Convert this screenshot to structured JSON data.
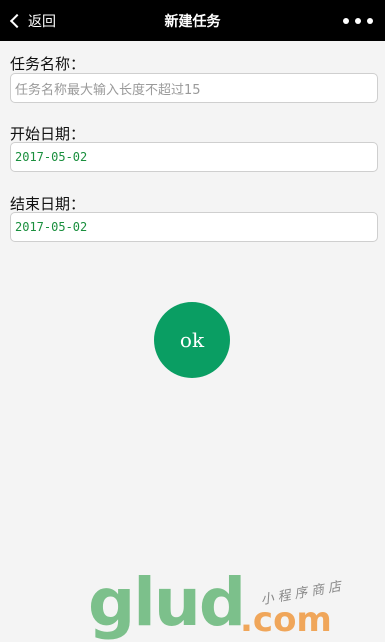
{
  "navbar": {
    "back_label": "返回",
    "title": "新建任务",
    "more_icon": "more-dots-icon"
  },
  "form": {
    "name_label": "任务名称：",
    "name_placeholder": "任务名称最大输入长度不超过15",
    "start_label": "开始日期：",
    "start_value": "2017-05-02",
    "end_label": "结束日期：",
    "end_value": "2017-05-02"
  },
  "submit": {
    "label": "ok",
    "color": "#0a9e63"
  },
  "watermark": {
    "logo_main": "glud",
    "logo_suffix": ".com",
    "tagline": "小程序商店"
  }
}
